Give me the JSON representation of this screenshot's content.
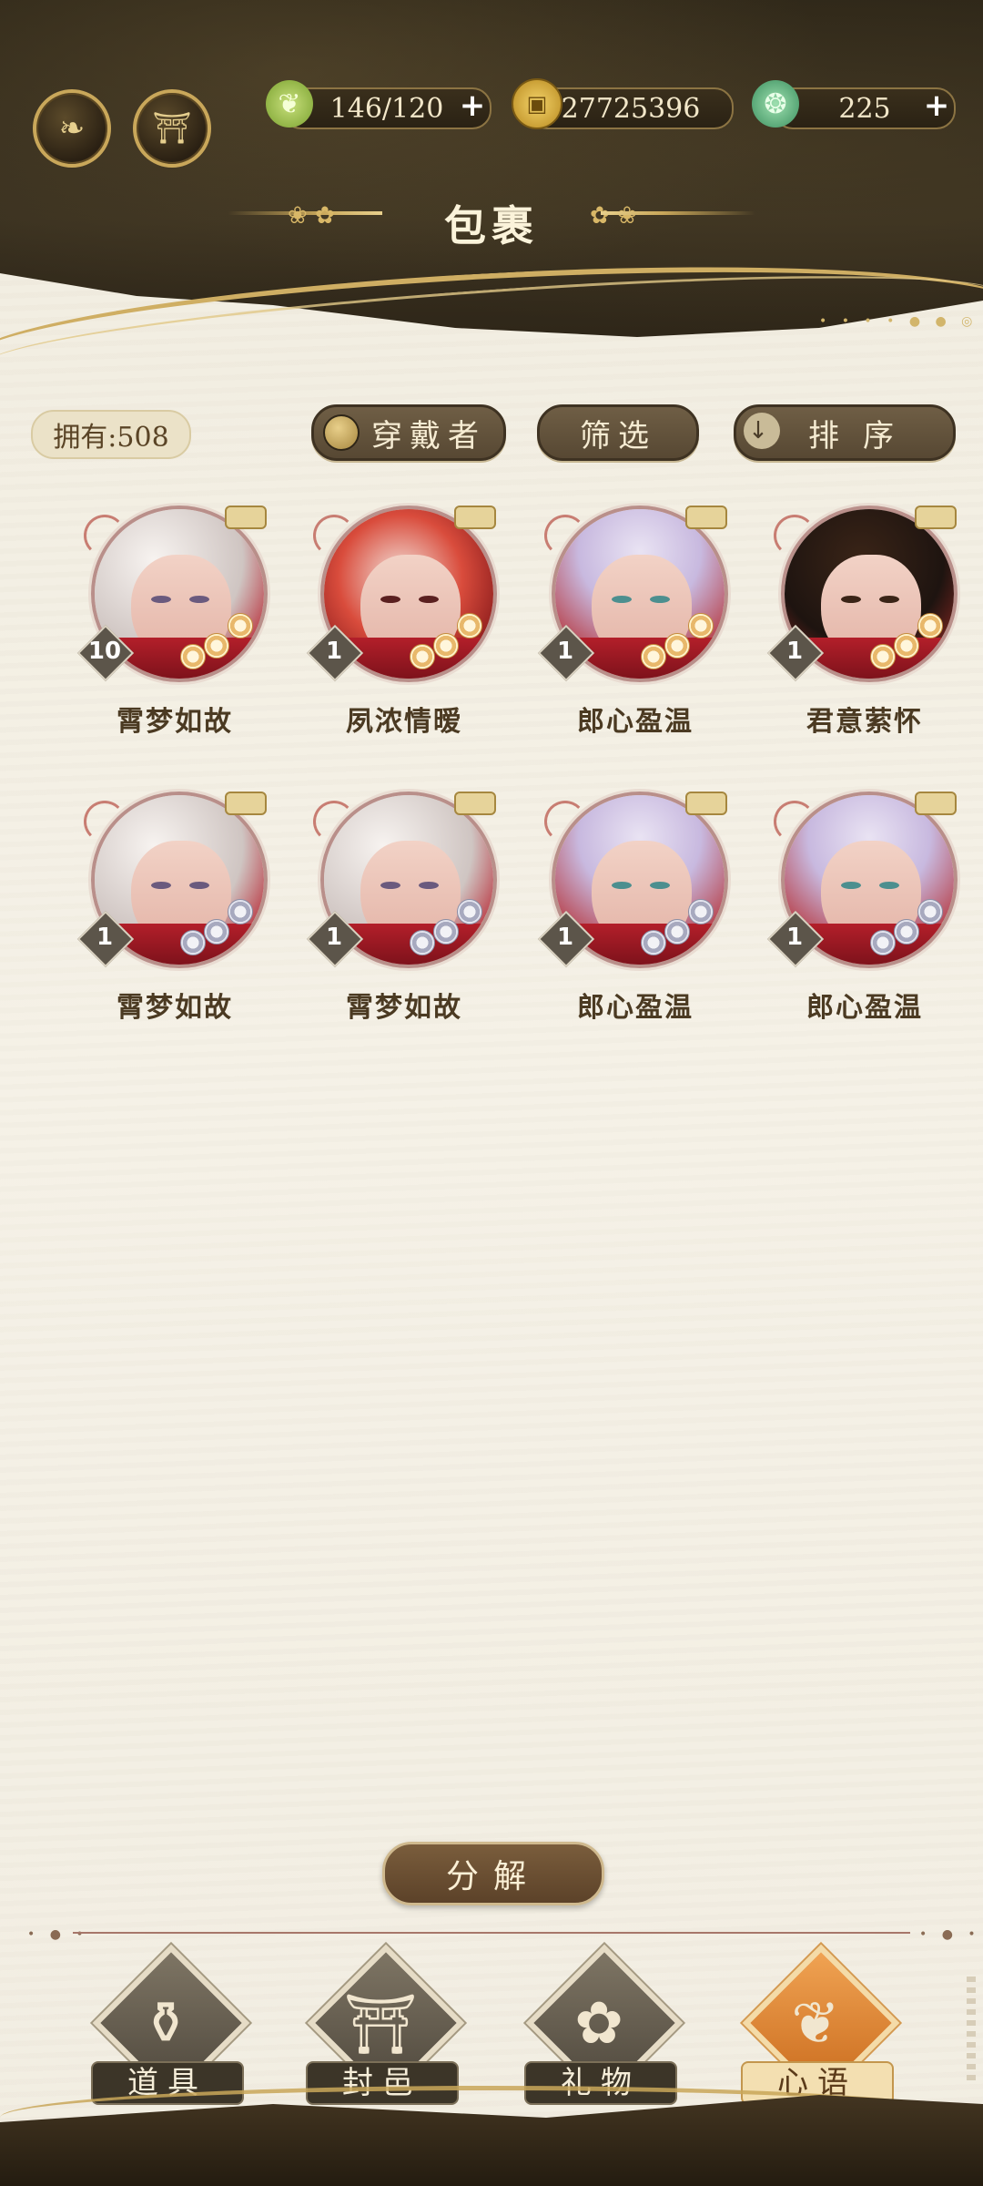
{
  "header": {
    "title": "包裹",
    "resources": [
      {
        "icon": "leaf-icon",
        "value": "146/120",
        "has_plus": true
      },
      {
        "icon": "copper-coin-icon",
        "value": "27725396",
        "has_plus": false
      },
      {
        "icon": "jade-cicada-icon",
        "value": "225",
        "has_plus": true
      }
    ],
    "plus_symbol": "+"
  },
  "toolbar": {
    "owned_count": "拥有:508",
    "wearer_label": "穿戴者",
    "filter_label": "筛选",
    "sort_label": "排序",
    "sort_arrow": "↓"
  },
  "items": [
    {
      "name": "霄梦如故",
      "level": "10",
      "theme": "silver",
      "blossom": "gold"
    },
    {
      "name": "夙浓情暧",
      "level": "1",
      "theme": "red",
      "blossom": "gold"
    },
    {
      "name": "郎心盈温",
      "level": "1",
      "theme": "lavender",
      "blossom": "gold"
    },
    {
      "name": "君意萦怀",
      "level": "1",
      "theme": "dark",
      "blossom": "gold"
    },
    {
      "name": "霄梦如故",
      "level": "1",
      "theme": "silver",
      "blossom": "grey"
    },
    {
      "name": "霄梦如故",
      "level": "1",
      "theme": "silver",
      "blossom": "grey"
    },
    {
      "name": "郎心盈温",
      "level": "1",
      "theme": "lavender",
      "blossom": "grey"
    },
    {
      "name": "郎心盈温",
      "level": "1",
      "theme": "lavender",
      "blossom": "grey"
    }
  ],
  "actions": {
    "decompose_label": "分解"
  },
  "bottom_nav": [
    {
      "label": "道具",
      "icon": "jar-icon",
      "glyph": "⚱",
      "active": false
    },
    {
      "label": "封邑",
      "icon": "palace-icon",
      "glyph": "⛩",
      "active": false
    },
    {
      "label": "礼物",
      "icon": "folding-fan-icon",
      "glyph": "✿",
      "active": false
    },
    {
      "label": "心语",
      "icon": "heart-knot-icon",
      "glyph": "❦",
      "active": true
    }
  ],
  "colors": {
    "header_dark": "#2d2618",
    "gold": "#c9a75a",
    "paper": "#f3efe3",
    "active_orange": "#e58a33"
  }
}
